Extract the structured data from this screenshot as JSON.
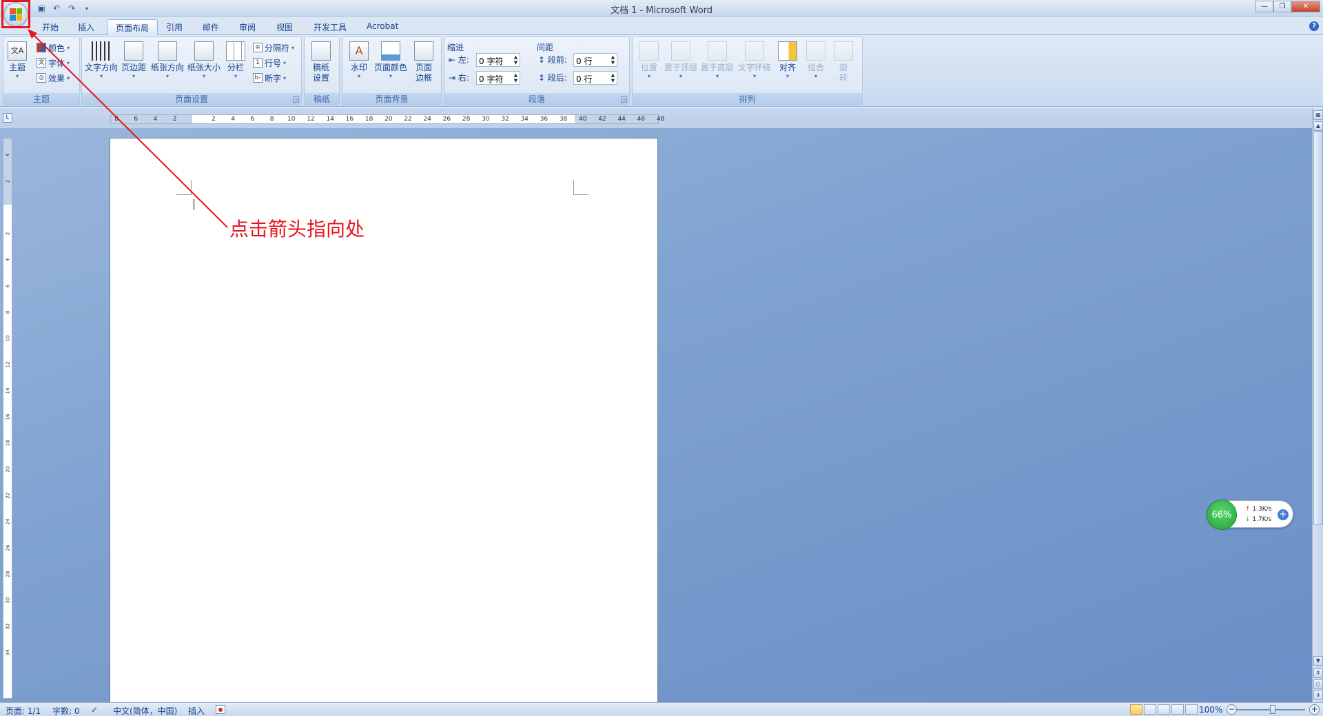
{
  "window": {
    "title": "文档 1 - Microsoft Word"
  },
  "qat": {
    "save_icon": "save-icon",
    "undo_icon": "undo-icon",
    "redo_icon": "redo-icon"
  },
  "tabs": [
    {
      "label": "开始"
    },
    {
      "label": "插入"
    },
    {
      "label": "页面布局"
    },
    {
      "label": "引用"
    },
    {
      "label": "邮件"
    },
    {
      "label": "审阅"
    },
    {
      "label": "视图"
    },
    {
      "label": "开发工具"
    },
    {
      "label": "Acrobat"
    }
  ],
  "ribbon": {
    "theme": {
      "group_label": "主题",
      "themes_label": "主题",
      "colors_label": "颜色",
      "fonts_label": "字体",
      "effects_label": "效果"
    },
    "page_setup": {
      "group_label": "页面设置",
      "text_direction_label": "文字方向",
      "margins_label": "页边距",
      "orientation_label": "纸张方向",
      "size_label": "纸张大小",
      "columns_label": "分栏",
      "breaks_label": "分隔符",
      "line_numbers_label": "行号",
      "hyphenation_label": "断字"
    },
    "draft": {
      "group_label": "稿纸",
      "draft_settings_label_1": "稿纸",
      "draft_settings_label_2": "设置"
    },
    "page_background": {
      "group_label": "页面背景",
      "watermark_label": "水印",
      "page_color_label": "页面颜色",
      "page_borders_label_1": "页面",
      "page_borders_label_2": "边框"
    },
    "paragraph": {
      "group_label": "段落",
      "indent_heading": "缩进",
      "spacing_heading": "间距",
      "left_label": "左:",
      "right_label": "右:",
      "before_label": "段前:",
      "after_label": "段后:",
      "left_value": "0 字符",
      "right_value": "0 字符",
      "before_value": "0 行",
      "after_value": "0 行"
    },
    "arrange": {
      "group_label": "排列",
      "position_label": "位置",
      "bring_front_label": "置于顶层",
      "send_back_label": "置于底层",
      "wrap_label": "文字环绕",
      "align_label": "对齐",
      "group_btn_label": "组合",
      "rotate_label_1": "旋",
      "rotate_label_2": "转"
    }
  },
  "ruler": {
    "ticks": [
      "8",
      "6",
      "4",
      "2",
      "",
      "2",
      "4",
      "6",
      "8",
      "10",
      "12",
      "14",
      "16",
      "18",
      "20",
      "22",
      "24",
      "26",
      "28",
      "30",
      "32",
      "34",
      "36",
      "38",
      "40",
      "42",
      "44",
      "46",
      "48"
    ],
    "vticks": [
      "4",
      "2",
      "",
      "2",
      "4",
      "6",
      "8",
      "10",
      "12",
      "14",
      "16",
      "18",
      "20",
      "22",
      "24",
      "26",
      "28",
      "30",
      "32",
      "34"
    ]
  },
  "annotation": {
    "text": "点击箭头指向处"
  },
  "net_widget": {
    "percent": "66%",
    "upload": "1.3K/s",
    "download": "1.7K/s"
  },
  "statusbar": {
    "page": "页面: 1/1",
    "words": "字数: 0",
    "language": "中文(简体，中国)",
    "mode": "插入",
    "zoom": "100%"
  }
}
